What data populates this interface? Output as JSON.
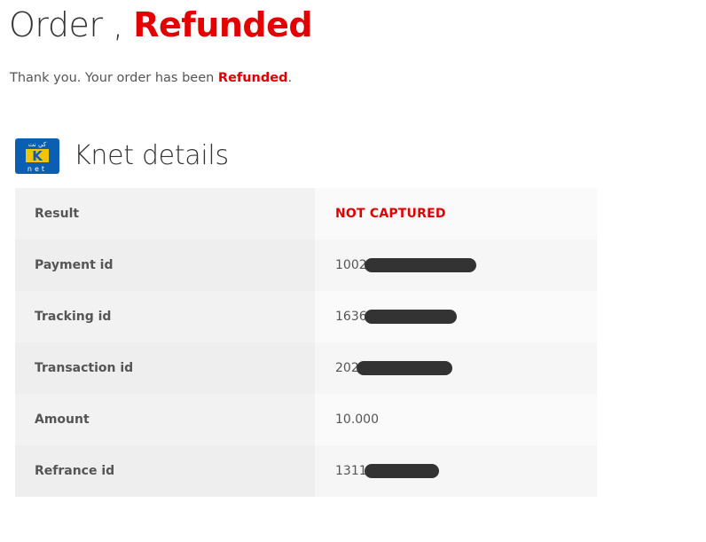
{
  "header": {
    "order_word": "Order",
    "separator": " , ",
    "status": "Refunded"
  },
  "message": {
    "prefix": "Thank you. Your order has been ",
    "status": "Refunded",
    "suffix": "."
  },
  "knet": {
    "logo_text_top": "كي نت",
    "logo_letter": "K",
    "logo_text_bottom": "net",
    "title": "Knet details"
  },
  "details": [
    {
      "label": "Result",
      "value": "NOT CAPTURED",
      "emphasis": true
    },
    {
      "label": "Payment id",
      "value": "1002",
      "redacted": true
    },
    {
      "label": "Tracking id",
      "value": "1636",
      "redacted": true
    },
    {
      "label": "Transaction id",
      "value": "202",
      "redacted": true
    },
    {
      "label": "Amount",
      "value": "10.000"
    },
    {
      "label": "Refrance id",
      "value": "1311",
      "redacted": true
    }
  ],
  "colors": {
    "status_red": "#e40000",
    "knet_blue": "#0b5fb0",
    "knet_yellow": "#f5c400"
  }
}
